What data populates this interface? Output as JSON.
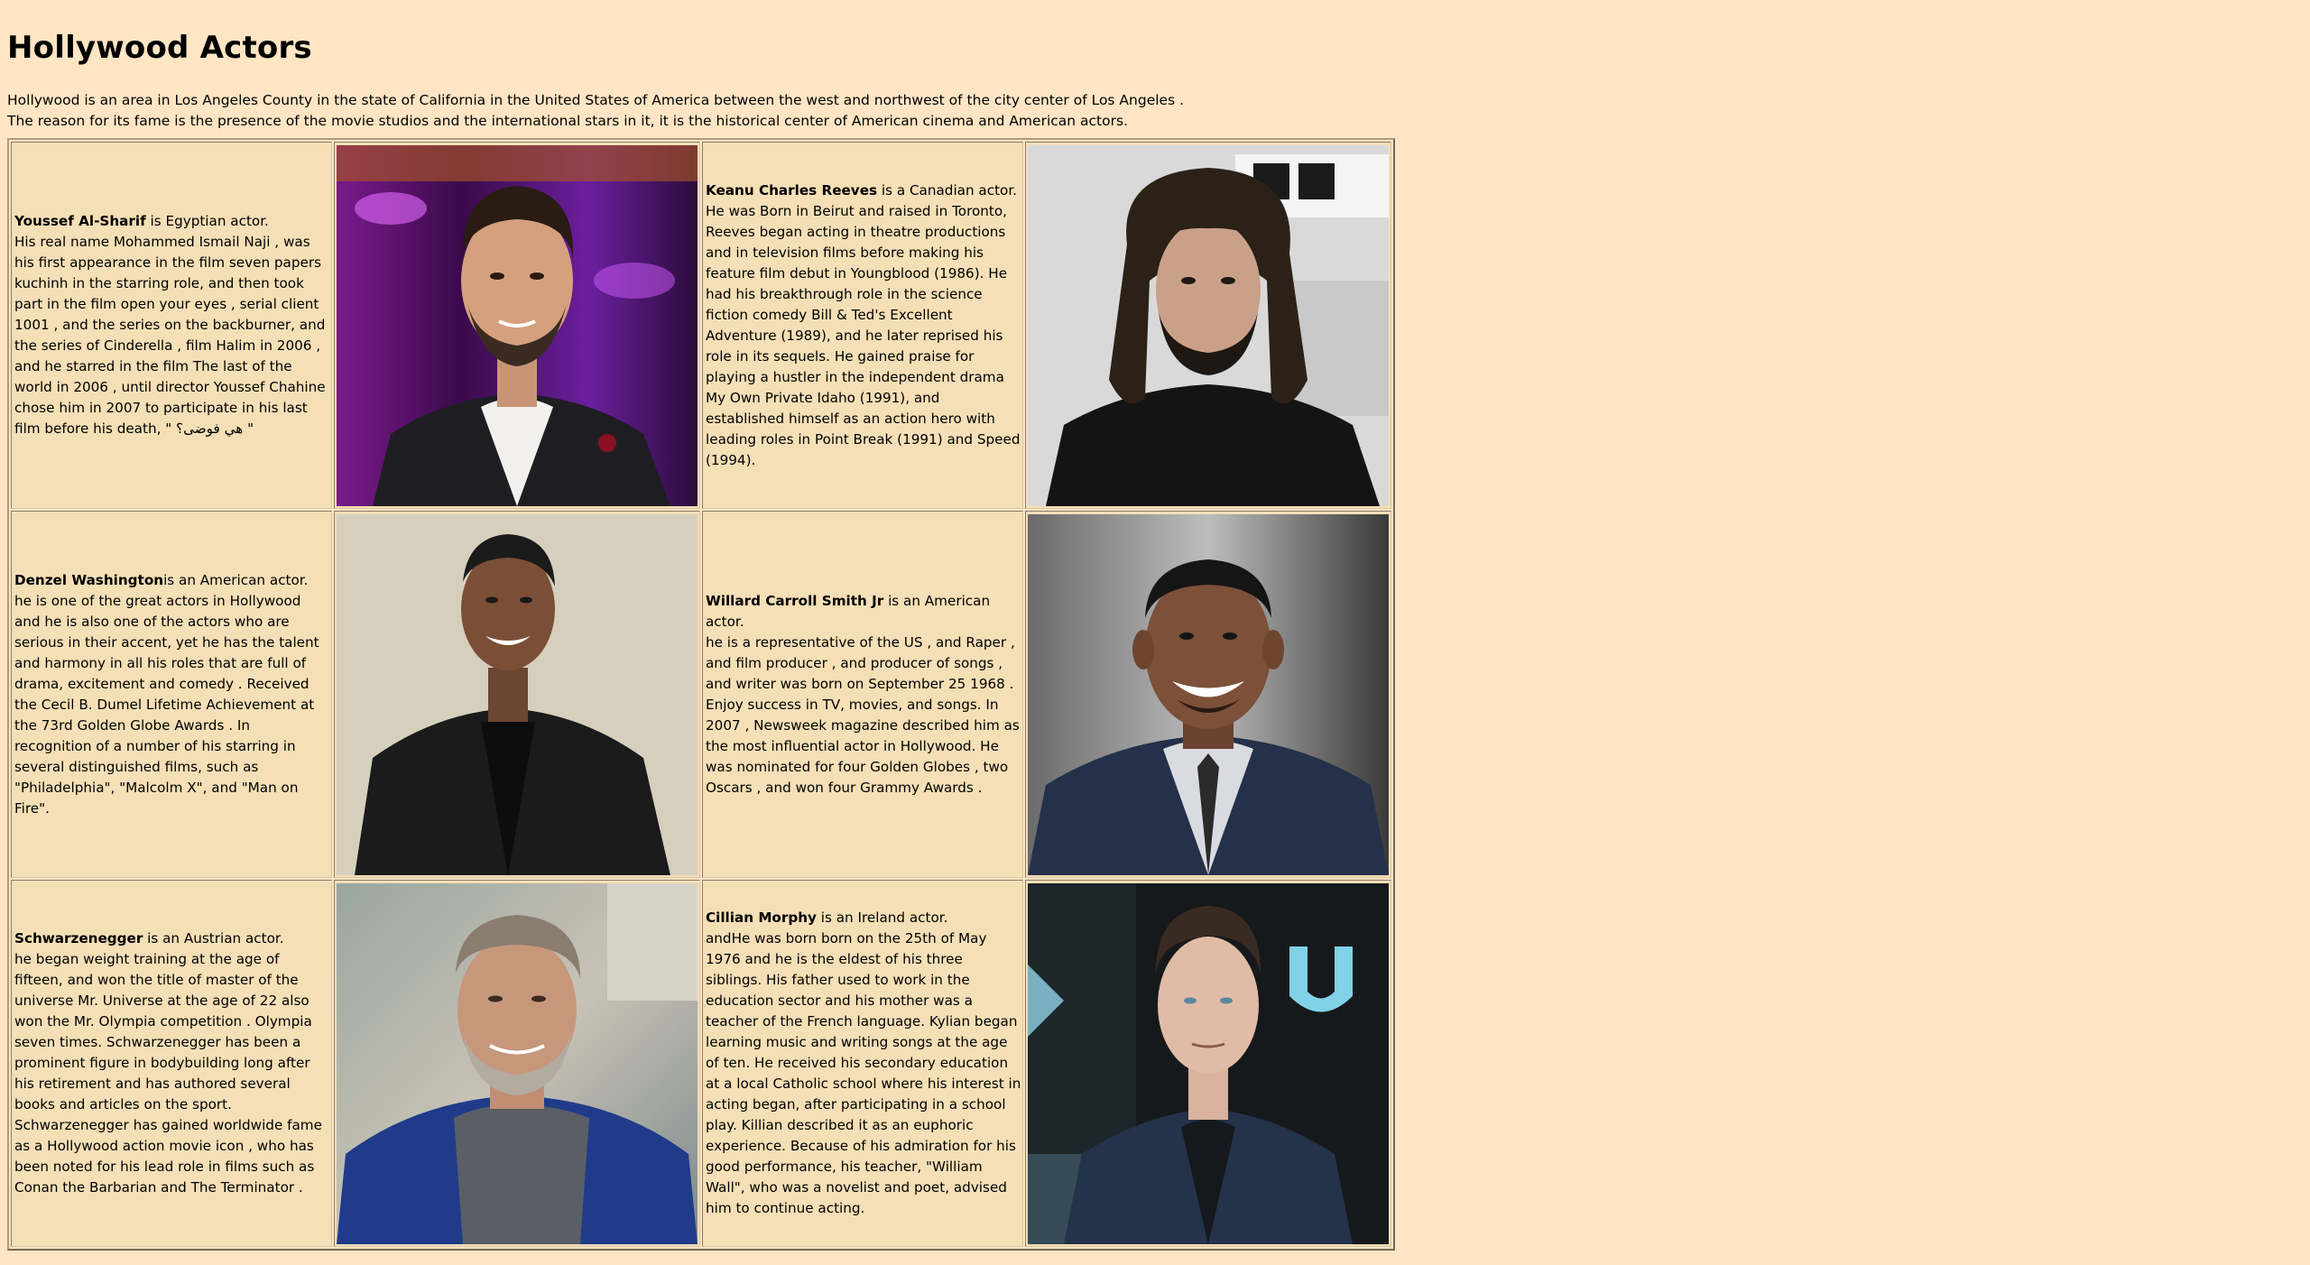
{
  "page": {
    "title": "Hollywood Actors",
    "intro_line1": "Hollywood is an area in Los Angeles County in the state of California in the United States of America between the west and northwest of the city center of Los Angeles .",
    "intro_line2": "The reason for its fame is the presence of the movie studios and the international stars in it, it is the historical center of American cinema and American actors."
  },
  "actors": [
    {
      "name": "Youssef Al-Sharif",
      "tagline": " is Egyptian actor.",
      "bio": "His real name Mohammed Ismail Naji , was his first appearance in the film seven papers kuchinh in the starring role, and then took part in the film open your eyes , serial client 1001 , and the series on the backburner, and the series of Cinderella , film Halim in 2006 , and he starred in the film The last of the world in 2006 , until director Youssef Chahine chose him in 2007 to participate in his last film before his death, \" هي فوضى؟ \"",
      "photo_alt": "Youssef Al-Sharif portrait"
    },
    {
      "name": "Keanu Charles Reeves",
      "tagline": " is a Canadian actor.",
      "bio": "He was Born in Beirut and raised in Toronto, Reeves began acting in theatre productions and in television films before making his feature film debut in Youngblood (1986). He had his breakthrough role in the science fiction comedy Bill & Ted's Excellent Adventure (1989), and he later reprised his role in its sequels. He gained praise for playing a hustler in the independent drama My Own Private Idaho (1991), and established himself as an action hero with leading roles in Point Break (1991) and Speed (1994).",
      "photo_alt": "Keanu Reeves portrait"
    },
    {
      "name": "Denzel Washington",
      "tagline": "is an American actor.",
      "bio": "he is one of the great actors in Hollywood and he is also one of the actors who are serious in their accent, yet he has the talent and harmony in all his roles that are full of drama, excitement and comedy . Received the Cecil B. Dumel Lifetime Achievement at the 73rd Golden Globe Awards . In recognition of a number of his starring in several distinguished films, such as \"Philadelphia\", \"Malcolm X\", and \"Man on Fire\".",
      "photo_alt": "Denzel Washington portrait"
    },
    {
      "name": "Willard Carroll Smith Jr",
      "tagline": " is an American actor.",
      "bio": "he is a representative of the US , and Raper , and film producer , and producer of songs , and writer was born on September 25 1968 . Enjoy success in TV, movies, and songs. In 2007 , Newsweek magazine described him as the most influential actor in Hollywood. He was nominated for four Golden Globes , two Oscars , and won four Grammy Awards .",
      "photo_alt": "Will Smith portrait"
    },
    {
      "name": "Schwarzenegger",
      "tagline": " is an Austrian actor.",
      "bio": "he began weight training at the age of fifteen, and won the title of master of the universe Mr. Universe at the age of 22 also won the Mr. Olympia competition . Olympia seven times. Schwarzenegger has been a prominent figure in bodybuilding long after his retirement and has authored several books and articles on the sport. Schwarzenegger has gained worldwide fame as a Hollywood action movie icon , who has been noted for his lead role in films such as Conan the Barbarian and The Terminator .",
      "photo_alt": "Arnold Schwarzenegger portrait"
    },
    {
      "name": "Cillian Morphy",
      "tagline": " is an Ireland actor.",
      "bio": "andHe was born born on the 25th of May 1976 and he is the eldest of his three siblings. His father used to work in the education sector and his mother was a teacher of the French language. Kylian began learning music and writing songs at the age of ten. He received his secondary education at a local Catholic school where his interest in acting began, after participating in a school play. Killian described it as an euphoric experience. Because of his admiration for his good performance, his teacher, \"William Wall\", who was a novelist and poet, advised him to continue acting.",
      "photo_alt": "Cillian Murphy portrait"
    }
  ],
  "colors": {
    "page_background": "#ffe5c4",
    "cell_background": "#f5dfb6"
  }
}
